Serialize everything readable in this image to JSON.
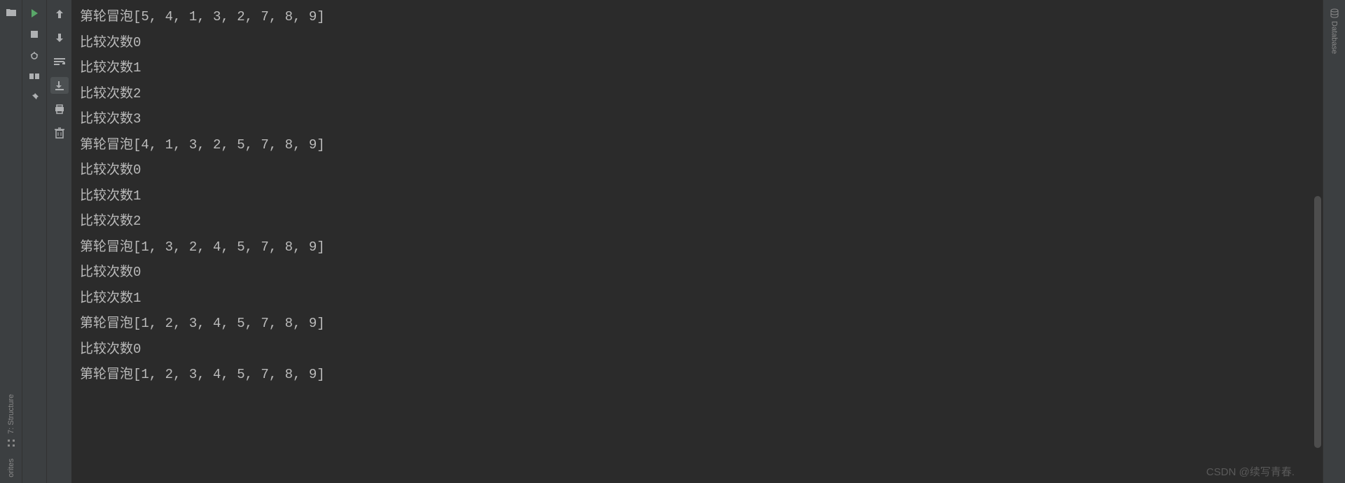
{
  "leftSidebar": {
    "structure": "7: Structure",
    "favorites": "orites"
  },
  "rightSidebar": {
    "database": "Database"
  },
  "console": {
    "lines": [
      "第轮冒泡[5, 4, 1, 3, 2, 7, 8, 9]",
      "比较次数0",
      "比较次数1",
      "比较次数2",
      "比较次数3",
      "第轮冒泡[4, 1, 3, 2, 5, 7, 8, 9]",
      "比较次数0",
      "比较次数1",
      "比较次数2",
      "第轮冒泡[1, 3, 2, 4, 5, 7, 8, 9]",
      "比较次数0",
      "比较次数1",
      "第轮冒泡[1, 2, 3, 4, 5, 7, 8, 9]",
      "比较次数0",
      "第轮冒泡[1, 2, 3, 4, 5, 7, 8, 9]"
    ]
  },
  "watermark": "CSDN @续写青春."
}
